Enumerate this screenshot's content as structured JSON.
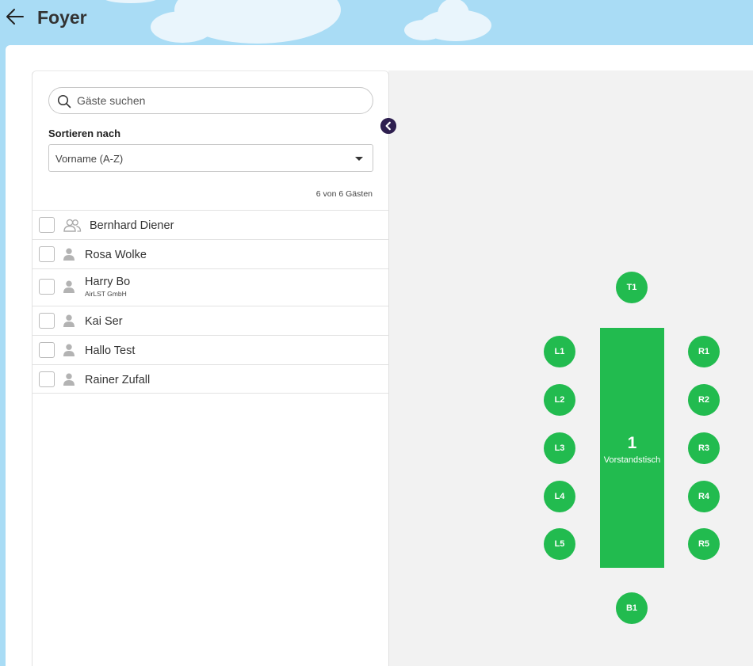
{
  "header": {
    "title": "Foyer",
    "back_icon": "arrow-left-icon"
  },
  "sidebar": {
    "search": {
      "placeholder": "Gäste suchen",
      "value": ""
    },
    "sort": {
      "label": "Sortieren nach",
      "selected": "Vorname (A-Z)"
    },
    "count_text": "6 von 6 Gästen",
    "guests": [
      {
        "name": "Bernhard Diener",
        "company": "",
        "icon": "group-icon"
      },
      {
        "name": "Rosa Wolke",
        "company": "",
        "icon": "person-icon"
      },
      {
        "name": "Harry Bo",
        "company": "AirLST GmbH",
        "icon": "person-icon"
      },
      {
        "name": "Kai Ser",
        "company": "",
        "icon": "person-icon"
      },
      {
        "name": "Hallo Test",
        "company": "",
        "icon": "person-icon"
      },
      {
        "name": "Rainer Zufall",
        "company": "",
        "icon": "person-icon"
      }
    ]
  },
  "seating": {
    "table": {
      "number": "1",
      "name": "Vorstandstisch"
    },
    "seats": {
      "top": "T1",
      "bottom": "B1",
      "left": [
        "L1",
        "L2",
        "L3",
        "L4",
        "L5"
      ],
      "right": [
        "R1",
        "R2",
        "R3",
        "R4",
        "R5"
      ]
    },
    "color": "#22bb4f"
  },
  "colors": {
    "sky": "#a9dcf5",
    "canvas": "#f2f2f2",
    "collapse_button": "#2e1f4f"
  }
}
